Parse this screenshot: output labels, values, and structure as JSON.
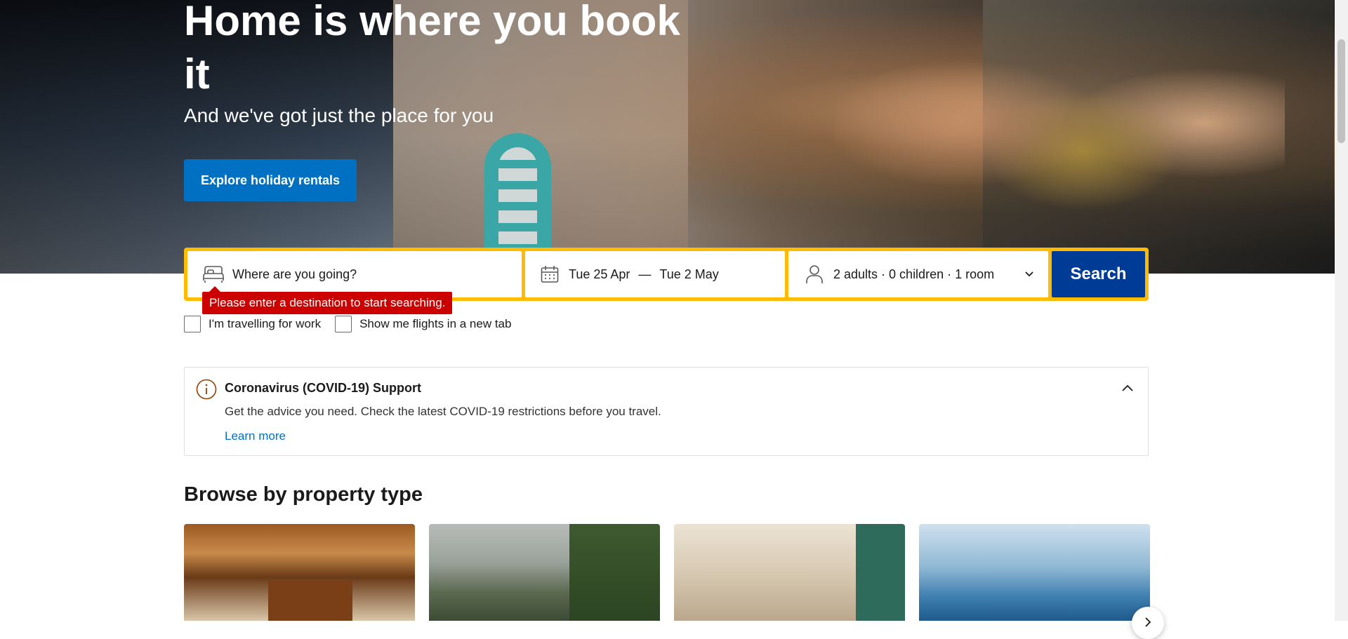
{
  "hero": {
    "title": "Home is where you book it",
    "subtitle": "And we've got just the place for you",
    "explore_button": "Explore holiday rentals"
  },
  "search": {
    "destination_placeholder": "Where are you going?",
    "check_in": "Tue 25 Apr",
    "date_separator": "—",
    "check_out": "Tue 2 May",
    "guests": "2 adults · 0 children · 1 room",
    "search_button": "Search",
    "error_tooltip": "Please enter a destination to start searching."
  },
  "options": {
    "work_travel": "I'm travelling for work",
    "flights_tab": "Show me flights in a new tab"
  },
  "covid": {
    "title": "Coronavirus (COVID-19) Support",
    "description": "Get the advice you need. Check the latest COVID-19 restrictions before you travel.",
    "link": "Learn more"
  },
  "browse": {
    "title": "Browse by property type"
  },
  "colors": {
    "brand_blue": "#0071c2",
    "dark_blue": "#003b95",
    "search_border": "#febb02",
    "error_red": "#cc0000"
  },
  "icons": [
    "bed-icon",
    "calendar-icon",
    "person-icon",
    "chevron-down-icon",
    "info-icon",
    "chevron-up-icon",
    "chevron-right-icon"
  ]
}
